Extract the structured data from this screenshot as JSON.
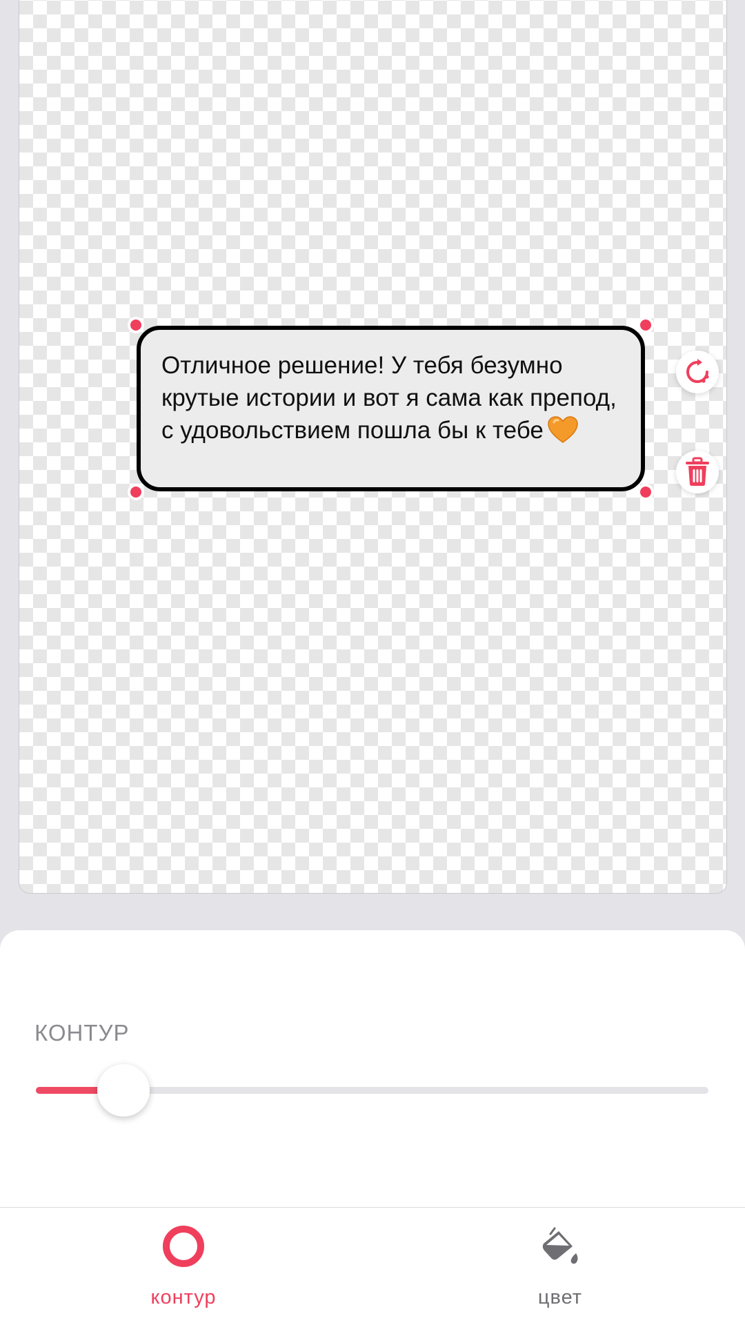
{
  "sticker": {
    "message_text": "Отличное решение! У тебя безумно крутые истории и вот я сама как препод, с удовольствием пошла бы к тебе",
    "emoji": "orange-heart-icon",
    "bubble_fill": "#ececec",
    "outline_color": "#000000"
  },
  "actions": {
    "rotate_icon": "rotate-icon",
    "delete_icon": "trash-icon"
  },
  "panel": {
    "section_label": "КОНТУР",
    "outline_slider": {
      "value_percent": 13
    }
  },
  "tabs": [
    {
      "label": "контур",
      "icon": "outline-circle-icon",
      "active": true
    },
    {
      "label": "цвет",
      "icon": "paint-bucket-icon",
      "active": false
    }
  ],
  "colors": {
    "accent": "#ef3f5c",
    "inactive": "#6e6e73",
    "background": "#e4e3e8"
  }
}
